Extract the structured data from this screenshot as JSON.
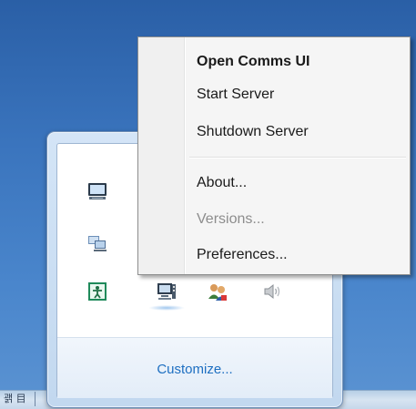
{
  "context_menu": {
    "items": [
      {
        "label": "Open Comms UI",
        "bold": true,
        "enabled": true
      },
      {
        "label": "Start Server",
        "bold": false,
        "enabled": true
      },
      {
        "label": "Shutdown Server",
        "bold": false,
        "enabled": true
      },
      {
        "label": "About...",
        "bold": false,
        "enabled": true
      },
      {
        "label": "Versions...",
        "bold": false,
        "enabled": false
      },
      {
        "label": "Preferences...",
        "bold": false,
        "enabled": true
      }
    ]
  },
  "tray_flyout": {
    "icons": [
      "display-icon",
      "network-computers-icon",
      "accessibility-icon",
      "comms-server-icon",
      "users-icon",
      "volume-icon"
    ],
    "customize_label": "Customize..."
  },
  "taskbar": {
    "glyph_text": "괡 目"
  },
  "colors": {
    "desktop": "#3a74bd",
    "link": "#1e6fc1",
    "disabled_text": "#8d8d8d"
  }
}
